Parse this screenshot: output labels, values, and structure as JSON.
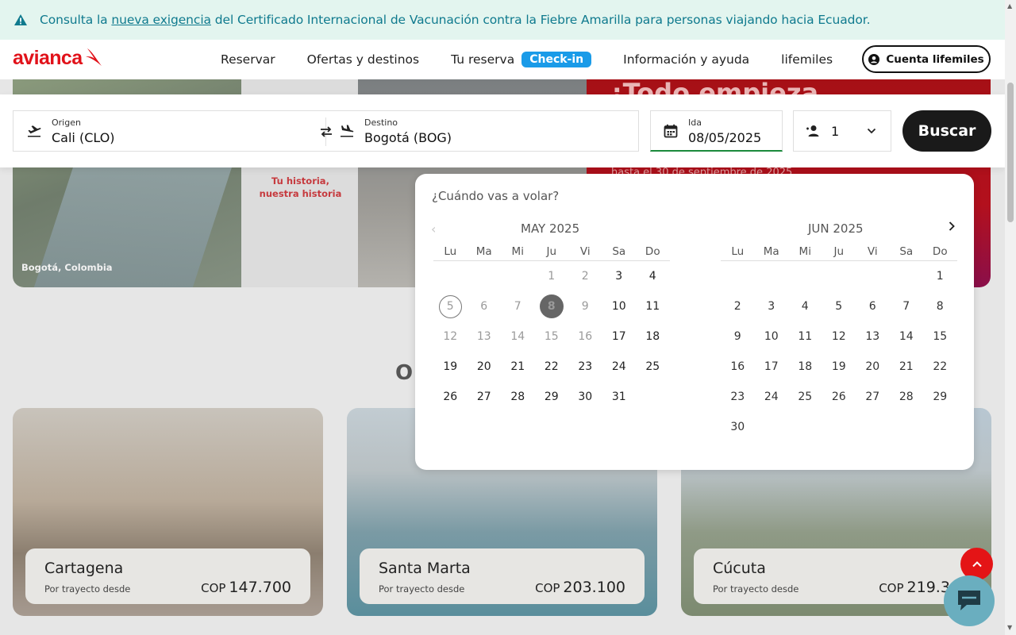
{
  "banner": {
    "prefix": "Consulta la ",
    "link": "nueva exigencia",
    "suffix": " del Certificado Internacional de Vacunación contra la Fiebre Amarilla para personas viajando hacia Ecuador."
  },
  "header": {
    "logo": "avianca",
    "nav": [
      {
        "label": "Reservar"
      },
      {
        "label": "Ofertas y destinos"
      },
      {
        "label": "Tu reserva",
        "badge": "Check-in"
      },
      {
        "label": "Información y ayuda"
      },
      {
        "label": "lifemiles"
      }
    ],
    "account": "Cuenta lifemiles"
  },
  "hero": {
    "caption": "Bogotá, Colombia",
    "story": "Tu historia, nuestra historia",
    "promo": "¡Todo empieza",
    "promo_sub": "hasta el 30 de septiembre de 2025"
  },
  "search": {
    "origin_label": "Origen",
    "origin_value": "Cali  (CLO)",
    "destination_label": "Destino",
    "destination_value": "Bogotá  (BOG)",
    "date_label": "Ida",
    "date_value": "08/05/2025",
    "passengers": "1",
    "button": "Buscar"
  },
  "calendar": {
    "question": "¿Cuándo vas a volar?",
    "weekdays": [
      "Lu",
      "Ma",
      "Mi",
      "Ju",
      "Vi",
      "Sa",
      "Do"
    ],
    "months": [
      {
        "title": "MAY 2025",
        "offset": 3,
        "days": 31,
        "today": 5,
        "selected": 8,
        "first_enabled": 17
      },
      {
        "title": "JUN 2025",
        "offset": 6,
        "days": 30
      }
    ]
  },
  "section": {
    "partial_title": "O"
  },
  "cards": [
    {
      "city": "Cartagena",
      "sub": "Por trayecto desde",
      "currency": "COP",
      "price": "147.700"
    },
    {
      "city": "Santa Marta",
      "sub": "Por trayecto desde",
      "currency": "COP",
      "price": "203.100"
    },
    {
      "city": "Cúcuta",
      "sub": "Por trayecto desde",
      "currency": "COP",
      "price": "219.30"
    }
  ],
  "colors": {
    "brand": "#e1121a",
    "banner_text": "#0f7a8e",
    "checkin": "#1a9be8",
    "date_underline": "#1b8a3c"
  },
  "icons": [
    "warning-icon",
    "user-icon",
    "takeoff-icon",
    "landing-icon",
    "swap-icon",
    "calendar-icon",
    "add-person-icon",
    "chevron-down-icon",
    "chevron-left-icon",
    "chevron-right-icon",
    "arrow-up-icon",
    "chat-icon"
  ]
}
